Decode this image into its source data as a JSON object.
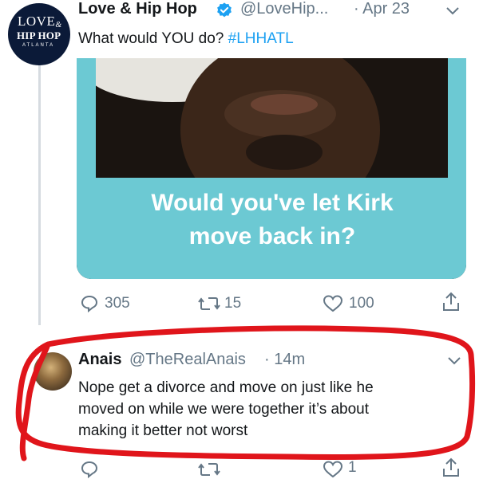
{
  "tweet": {
    "avatar": {
      "line1": "LOVE",
      "line1_small": "&",
      "line2": "HIP HOP",
      "line3": "ATLANTA"
    },
    "name": "Love & Hip Hop",
    "handle": "@LoveHip...",
    "date": "· Apr 23",
    "text": "What would YOU do?",
    "hashtag": "#LHHATL",
    "media_caption_line1": "Would you've let Kirk",
    "media_caption_line2": "move back in?",
    "replies": "305",
    "retweets": "15",
    "likes": "100"
  },
  "reply": {
    "name": "Anais",
    "handle": "@TheRealAnais",
    "time": "· 14m",
    "text_line1": "Nope get a divorce and move on just like he",
    "text_line2": "moved on while we were together it’s about",
    "text_line3": "making it better not worst",
    "likes": "1"
  },
  "colors": {
    "accent": "#1da1f2",
    "teal": "#6cc9d3",
    "annotation": "#e0151b",
    "muted": "#657786"
  },
  "icons": [
    "verified-icon",
    "chevron-down-icon",
    "reply-icon",
    "retweet-icon",
    "like-icon",
    "share-icon"
  ]
}
